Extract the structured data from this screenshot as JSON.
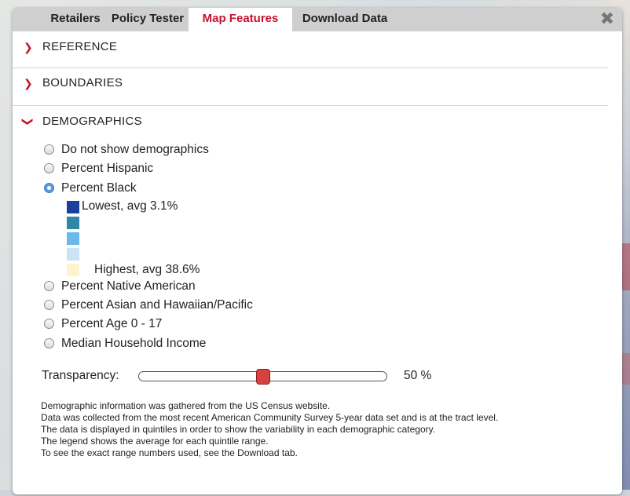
{
  "tabs": [
    {
      "label": "Retailers"
    },
    {
      "label": "Policy Tester"
    },
    {
      "label": "Map Features",
      "active": true
    },
    {
      "label": "Download Data"
    }
  ],
  "close_icon": "close-icon",
  "sections": {
    "reference": {
      "label": "REFERENCE",
      "expanded": false
    },
    "boundaries": {
      "label": "BOUNDARIES",
      "expanded": false
    },
    "demographics": {
      "label": "DEMOGRAPHICS",
      "expanded": true
    }
  },
  "demographics": {
    "options": [
      {
        "label": "Do not show demographics",
        "checked": false
      },
      {
        "label": "Percent Hispanic",
        "checked": false
      },
      {
        "label": "Percent Black",
        "checked": true
      },
      {
        "label": "Percent Native American",
        "checked": false
      },
      {
        "label": "Percent Asian and Hawaiian/Pacific",
        "checked": false
      },
      {
        "label": "Percent Age 0 - 17",
        "checked": false
      },
      {
        "label": "Median Household Income",
        "checked": false
      }
    ],
    "legend": {
      "lowest": "Lowest, avg 3.1%",
      "highest": "Highest, avg 38.6%",
      "colors": [
        "#1c3f9e",
        "#2f86a8",
        "#6bb8ea",
        "#c9e4f7",
        "#fdf3cf"
      ]
    }
  },
  "transparency": {
    "label": "Transparency:",
    "value_text": "50 %",
    "value": 0.5
  },
  "notes": [
    "Demographic information was gathered from the US Census website.",
    "Data was collected from the most recent American Community Survey 5-year data set and is at the tract level.",
    "The data is displayed in quintiles in order to show the variability in each demographic category.",
    "The legend shows the average for each quintile range.",
    "To see the exact range numbers used, see the Download tab."
  ],
  "colors": {
    "accent": "#c8102e",
    "tab_bar": "#cfcfcf",
    "radio_checked": "#5c9be3",
    "slider_handle": "#d94040"
  }
}
